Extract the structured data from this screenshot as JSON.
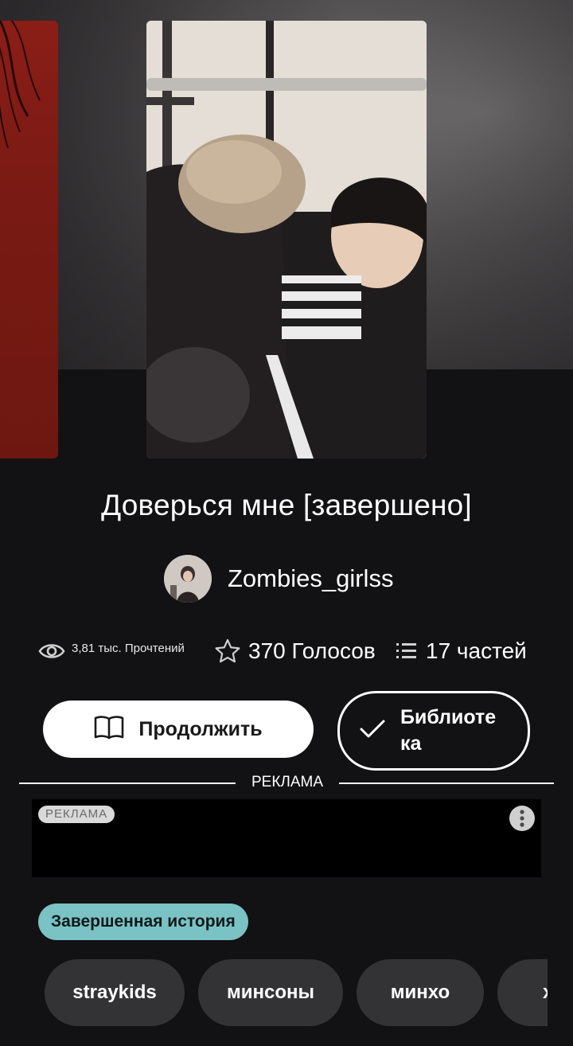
{
  "story": {
    "title": "Доверься мне [завершено]",
    "author": "Zombies_girlss"
  },
  "stats": {
    "reads": "3,81 тыс. Прочтений",
    "votes": "370 Голосов",
    "parts": "17 частей"
  },
  "actions": {
    "continue_label": "Продолжить",
    "library_label": "Библиотека"
  },
  "ad": {
    "divider_label": "РЕКЛАМА",
    "badge_label": "РЕКЛАМА"
  },
  "status_tag": "Завершенная история",
  "tags": [
    "straykids",
    "минсоны",
    "минхо",
    "х"
  ],
  "colors": {
    "background": "#121113",
    "status_tag": "#7bc2c4",
    "tag_pill": "#333235",
    "side_cover": "#7a1a14"
  },
  "icons": {
    "reads": "eye-icon",
    "votes": "star-icon",
    "parts": "list-icon",
    "continue": "book-icon",
    "library": "check-icon",
    "ad_menu": "more-vertical-icon"
  }
}
